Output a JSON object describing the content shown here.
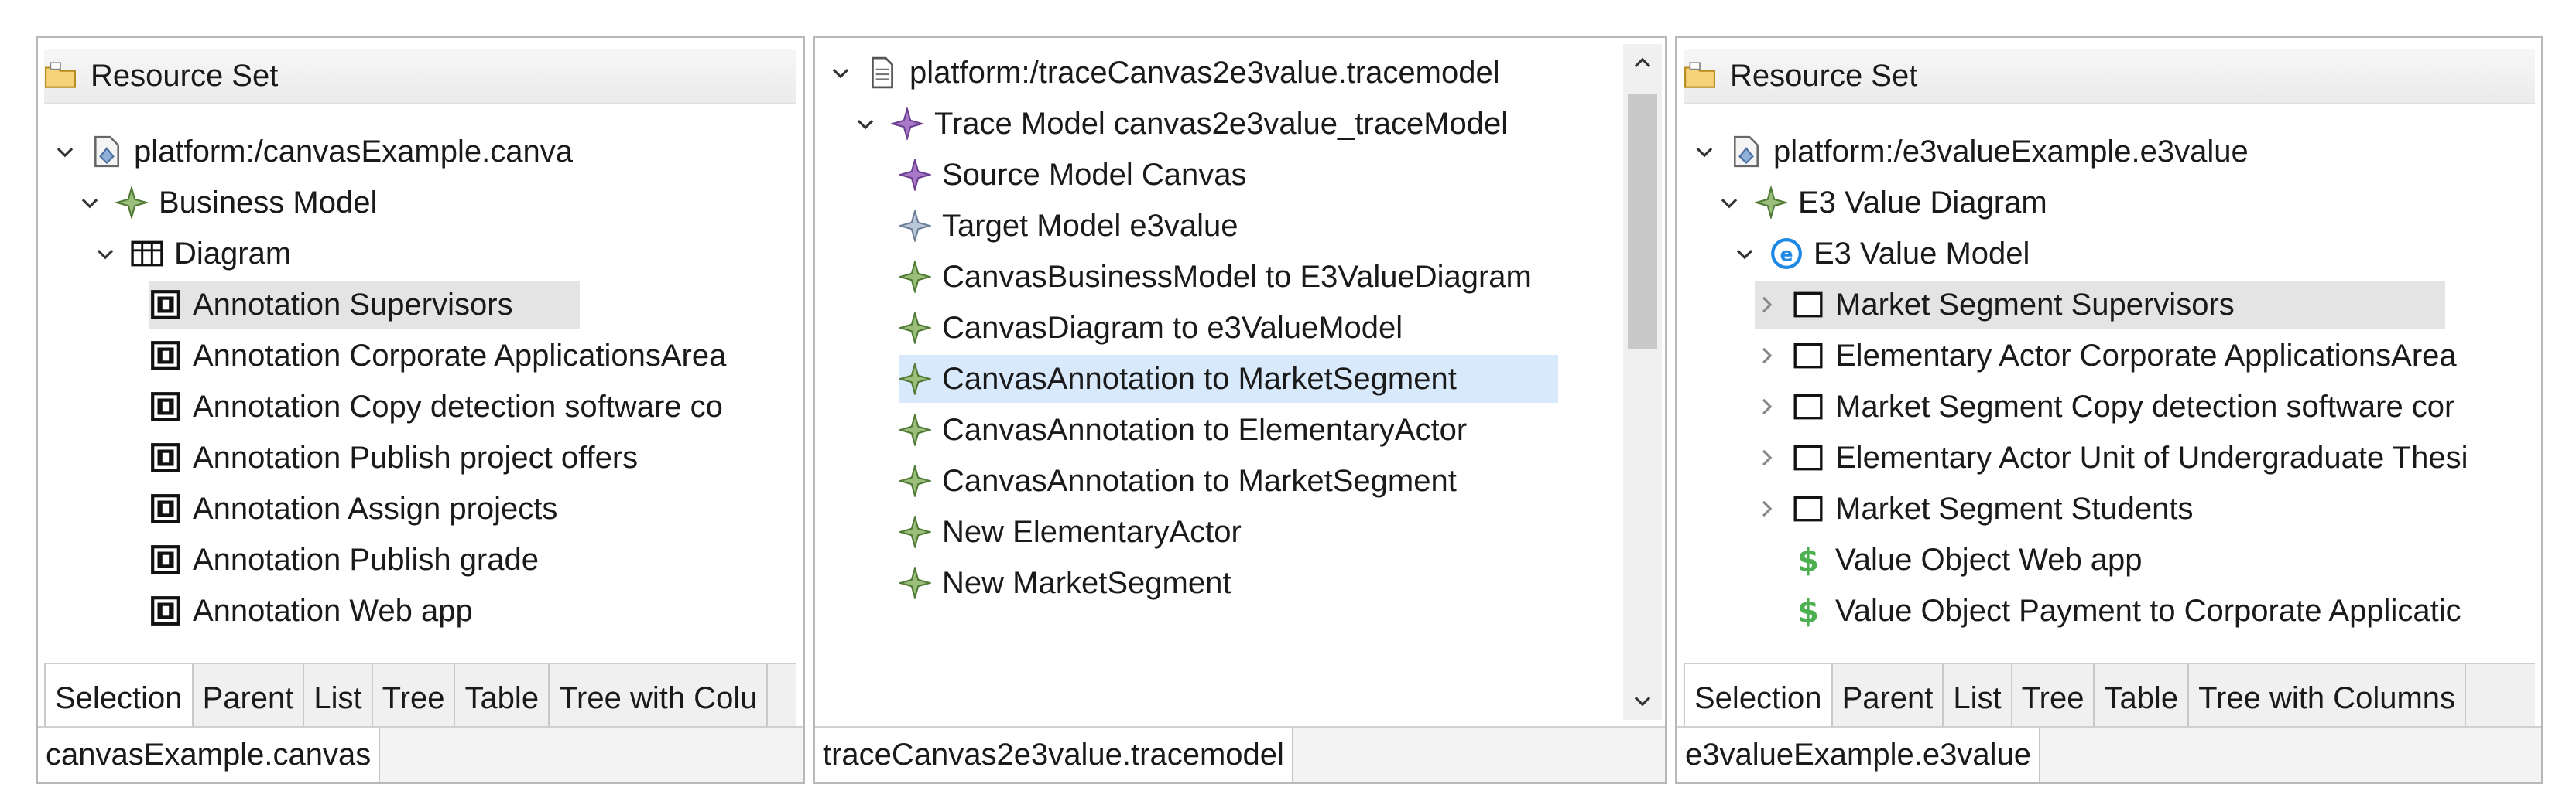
{
  "left_panel": {
    "header": "Resource Set",
    "tree": [
      {
        "label": "platform:/canvasExample.canva",
        "icon": "resource-file-icon",
        "chevron": "down"
      },
      {
        "label": "Business Model",
        "icon": "model-element-icon",
        "chevron": "down"
      },
      {
        "label": "Diagram",
        "icon": "grid-diagram-icon",
        "chevron": "down"
      },
      {
        "label": "Annotation Supervisors",
        "icon": "annotation-icon"
      },
      {
        "label": "Annotation Corporate ApplicationsArea",
        "icon": "annotation-icon"
      },
      {
        "label": "Annotation Copy detection software co",
        "icon": "annotation-icon"
      },
      {
        "label": "Annotation Publish project offers",
        "icon": "annotation-icon"
      },
      {
        "label": "Annotation Assign projects",
        "icon": "annotation-icon"
      },
      {
        "label": "Annotation Publish grade",
        "icon": "annotation-icon"
      },
      {
        "label": "Annotation Web app",
        "icon": "annotation-icon"
      }
    ],
    "tabs": [
      "Selection",
      "Parent",
      "List",
      "Tree",
      "Table",
      "Tree with Colu"
    ],
    "bottom_tab": "canvasExample.canvas"
  },
  "middle_panel": {
    "tree": [
      {
        "label": "platform:/traceCanvas2e3value.tracemodel",
        "icon": "document-icon",
        "chevron": "down"
      },
      {
        "label": "Trace Model canvas2e3value_traceModel",
        "icon": "trace-model-icon",
        "chevron": "down"
      },
      {
        "label": "Source Model Canvas",
        "icon": "source-model-icon"
      },
      {
        "label": "Target Model e3value",
        "icon": "target-model-icon"
      },
      {
        "label": "CanvasBusinessModel to E3ValueDiagram",
        "icon": "model-element-icon"
      },
      {
        "label": "CanvasDiagram to e3ValueModel",
        "icon": "model-element-icon"
      },
      {
        "label": "CanvasAnnotation to MarketSegment",
        "icon": "model-element-icon"
      },
      {
        "label": "CanvasAnnotation to ElementaryActor",
        "icon": "model-element-icon"
      },
      {
        "label": "CanvasAnnotation to MarketSegment",
        "icon": "model-element-icon"
      },
      {
        "label": "New ElementaryActor",
        "icon": "model-element-icon"
      },
      {
        "label": "New MarketSegment",
        "icon": "model-element-icon"
      }
    ],
    "bottom_tab": "traceCanvas2e3value.tracemodel"
  },
  "right_panel": {
    "header": "Resource Set",
    "tree": [
      {
        "label": "platform:/e3valueExample.e3value",
        "icon": "resource-file-icon",
        "chevron": "down"
      },
      {
        "label": "E3 Value Diagram",
        "icon": "value-diagram-icon",
        "chevron": "down"
      },
      {
        "label": "E3 Value Model",
        "icon": "e3-model-icon",
        "chevron": "down"
      },
      {
        "label": "Market Segment Supervisors",
        "icon": "box-icon",
        "chevron": "right"
      },
      {
        "label": "Elementary Actor Corporate ApplicationsArea",
        "icon": "box-icon",
        "chevron": "right"
      },
      {
        "label": "Market Segment Copy detection software cor",
        "icon": "box-icon",
        "chevron": "right"
      },
      {
        "label": "Elementary Actor Unit of Undergraduate Thesi",
        "icon": "box-icon",
        "chevron": "right"
      },
      {
        "label": "Market Segment Students",
        "icon": "box-icon",
        "chevron": "right"
      },
      {
        "label": "Value Object Web app",
        "icon": "dollar-icon"
      },
      {
        "label": "Value Object Payment to Corporate Applicatic",
        "icon": "dollar-icon"
      }
    ],
    "tabs": [
      "Selection",
      "Parent",
      "List",
      "Tree",
      "Table",
      "Tree with Columns"
    ],
    "bottom_tab": "e3valueExample.e3value"
  },
  "colors": {
    "selection_gray": "#e4e4e4",
    "selection_blue": "#d8e9fb",
    "element_green": "#6aa84f",
    "element_purple": "#8e5bb5",
    "dollar_green": "#4caf50",
    "e3_blue": "#1e88e5"
  }
}
